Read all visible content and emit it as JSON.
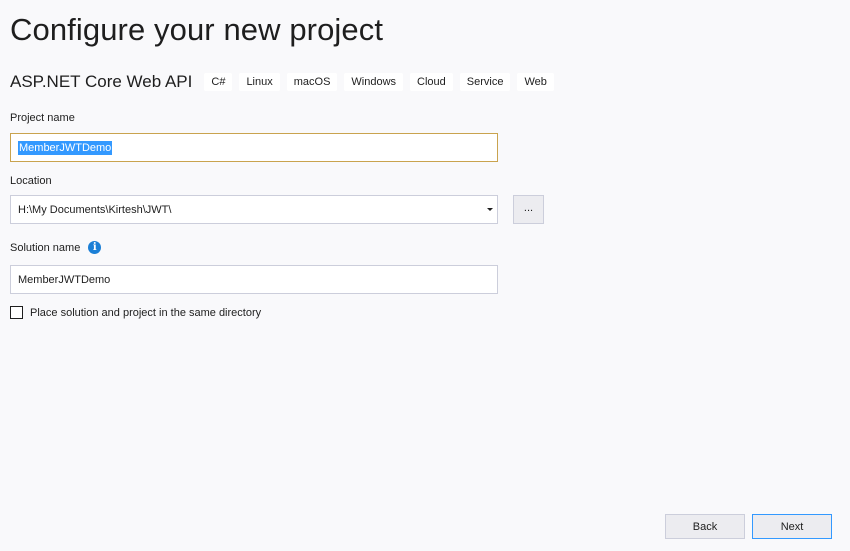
{
  "header": {
    "title": "Configure your new project"
  },
  "template": {
    "name": "ASP.NET Core Web API",
    "tags": [
      "C#",
      "Linux",
      "macOS",
      "Windows",
      "Cloud",
      "Service",
      "Web"
    ]
  },
  "project_name": {
    "label": "Project name",
    "value": "MemberJWTDemo"
  },
  "location": {
    "label": "Location",
    "value": "H:\\My Documents\\Kirtesh\\JWT\\",
    "browse_label": "..."
  },
  "solution_name": {
    "label": "Solution name",
    "info_icon": "i",
    "value": "MemberJWTDemo"
  },
  "same_directory": {
    "label": "Place solution and project in the same directory",
    "checked": false
  },
  "footer": {
    "back_label": "Back",
    "next_label": "Next"
  },
  "colors": {
    "accent": "#3399ff",
    "info": "#1b7fd6",
    "focus_border": "#c9a34e",
    "background": "#f9f9fb"
  }
}
